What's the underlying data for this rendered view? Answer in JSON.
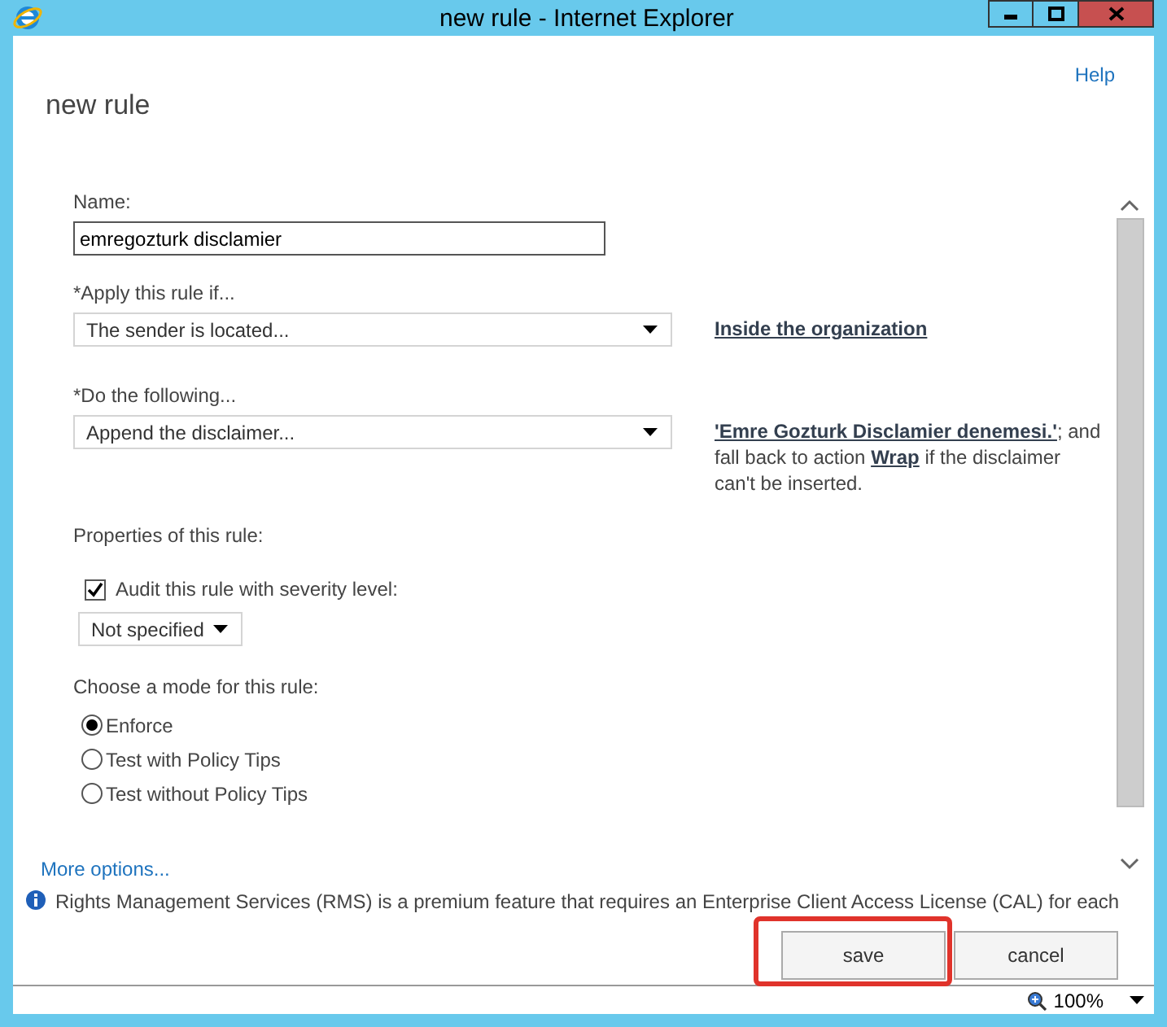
{
  "window": {
    "title": "new rule - Internet Explorer"
  },
  "help_link": "Help",
  "page_title": "new rule",
  "name_field": {
    "label": "Name:",
    "value": "emregozturk disclamier"
  },
  "conditions": [
    {
      "label": "*Apply this rule if...",
      "value": "The sender is located...",
      "detail": [
        {
          "kind": "link",
          "text": "Inside the organization"
        }
      ]
    },
    {
      "label": "*Do the following...",
      "value": "Append the disclaimer...",
      "detail": [
        {
          "kind": "link",
          "text": "'Emre Gozturk Disclamier denemesi.'"
        },
        {
          "kind": "text",
          "text": "; and fall back to action "
        },
        {
          "kind": "link",
          "text": "Wrap"
        },
        {
          "kind": "text",
          "text": " if the disclaimer can't be inserted."
        }
      ]
    }
  ],
  "properties": {
    "label": "Properties of this rule:",
    "audit": {
      "label": "Audit this rule with severity level:",
      "checked": true
    },
    "severity": "Not specified"
  },
  "mode": {
    "label": "Choose a mode for this rule:",
    "options": [
      {
        "label": "Enforce",
        "selected": true
      },
      {
        "label": "Test with Policy Tips",
        "selected": false
      },
      {
        "label": "Test without Policy Tips",
        "selected": false
      }
    ]
  },
  "more_options": "More options...",
  "notice": "Rights Management Services (RMS) is a premium feature that requires an Enterprise Client Access License (CAL) for each",
  "buttons": [
    {
      "label": "save",
      "highlighted": true
    },
    {
      "label": "cancel",
      "highlighted": false
    }
  ],
  "status_bar": {
    "zoom": "100%"
  }
}
